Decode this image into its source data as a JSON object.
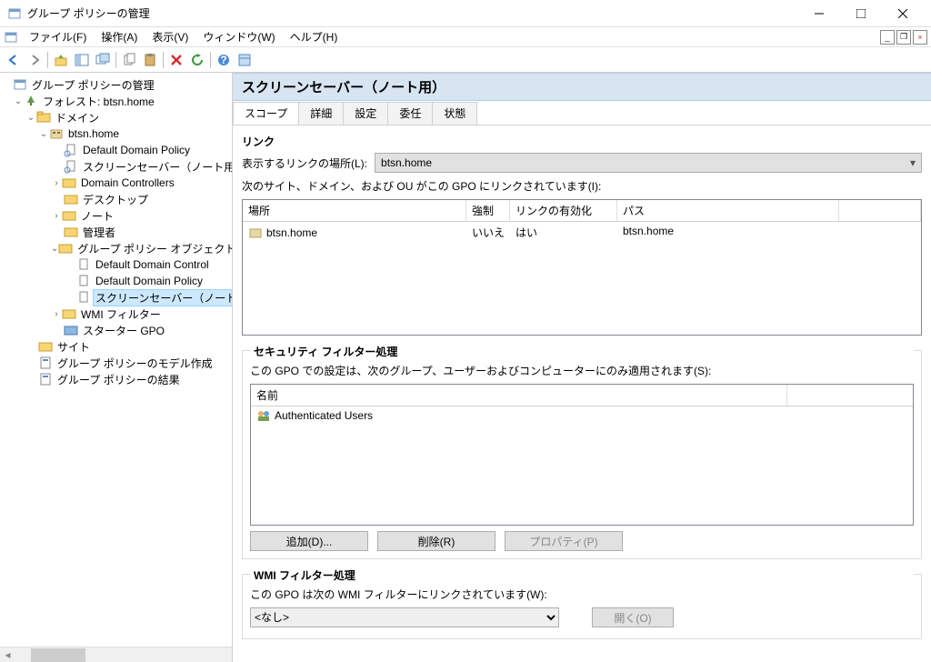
{
  "window": {
    "title": "グループ ポリシーの管理"
  },
  "menu": {
    "file": "ファイル(F)",
    "action": "操作(A)",
    "view": "表示(V)",
    "window": "ウィンドウ(W)",
    "help": "ヘルプ(H)"
  },
  "tree": {
    "root": "グループ ポリシーの管理",
    "forest": "フォレスト: btsn.home",
    "domains": "ドメイン",
    "domain": "btsn.home",
    "ddp": "Default Domain Policy",
    "ssn": "スクリーンセーバー（ノート用）",
    "dc": "Domain Controllers",
    "desktop": "デスクトップ",
    "note": "ノート",
    "admin": "管理者",
    "gpo_folder": "グループ ポリシー オブジェクト",
    "ddc": "Default Domain Control",
    "ddp2": "Default Domain Policy",
    "ssn2": "スクリーンセーバー（ノート用",
    "wmi": "WMI フィルター",
    "starter": "スターター GPO",
    "sites": "サイト",
    "modeling": "グループ ポリシーのモデル作成",
    "results": "グループ ポリシーの結果"
  },
  "detail": {
    "title": "スクリーンセーバー（ノート用）",
    "tabs": {
      "scope": "スコープ",
      "details": "詳細",
      "settings": "設定",
      "delegation": "委任",
      "status": "状態"
    },
    "links_heading": "リンク",
    "location_label": "表示するリンクの場所(L):",
    "location_value": "btsn.home",
    "linked_desc": "次のサイト、ドメイン、および OU がこの GPO にリンクされています(I):",
    "cols": {
      "location": "場所",
      "enforced": "強制",
      "enabled": "リンクの有効化",
      "path": "パス"
    },
    "row": {
      "location": "btsn.home",
      "enforced": "いいえ",
      "enabled": "はい",
      "path": "btsn.home"
    },
    "sec_heading": "セキュリティ フィルター処理",
    "sec_desc": "この GPO での設定は、次のグループ、ユーザーおよびコンピューターにのみ適用されます(S):",
    "sec_col": "名前",
    "sec_row": "Authenticated Users",
    "btn_add": "追加(D)...",
    "btn_remove": "削除(R)",
    "btn_prop": "プロパティ(P)",
    "wmi_heading": "WMI フィルター処理",
    "wmi_desc": "この GPO は次の WMI フィルターにリンクされています(W):",
    "wmi_value": "<なし>",
    "btn_open": "開く(O)"
  }
}
